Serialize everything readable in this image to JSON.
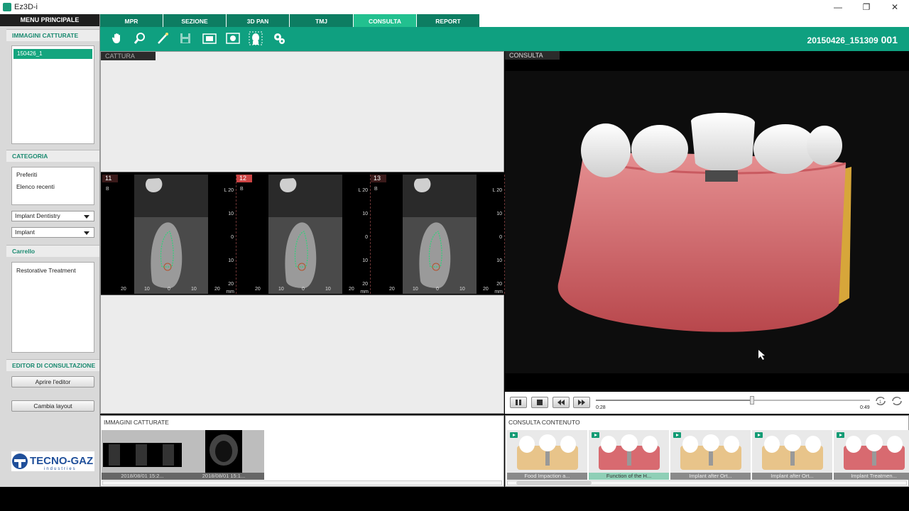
{
  "window": {
    "title": "Ez3D-i"
  },
  "sidebar": {
    "menu_label": "MENU PRINCIPALE",
    "captured_header": "IMMAGINI CATTURATE",
    "captured_items": [
      "150426_1"
    ],
    "category_header": "CATEGORIA",
    "category_items": [
      "Preferiti",
      "Elenco recenti"
    ],
    "dropdown1": "Implant Dentistry",
    "dropdown2": "Implant",
    "cart_header": "Carrello",
    "cart_items": [
      "Restorative Treatment"
    ],
    "editor_header": "EDITOR DI CONSULTAZIONE",
    "open_editor": "Aprire l'editor",
    "change_layout": "Cambia layout",
    "logo_text": "TECNO-GAZ",
    "logo_sub": "industries"
  },
  "tabs": [
    "MPR",
    "SEZIONE",
    "3D PAN",
    "TMJ",
    "CONSULTA",
    "REPORT"
  ],
  "active_tab": "CONSULTA",
  "toolbar": {
    "tools": [
      "hand-icon",
      "zoom-icon",
      "draw-icon",
      "save-icon",
      "capture-icon",
      "screenshot-icon",
      "face-icon",
      "settings-icon"
    ],
    "case_id": "20150426_151309",
    "case_num": "001"
  },
  "capture": {
    "label": "CATTURA",
    "slices": [
      {
        "num": "11",
        "marker": "B"
      },
      {
        "num": "12",
        "marker": "B"
      },
      {
        "num": "13",
        "marker": "B"
      }
    ],
    "right_ticks": [
      "L 20",
      "10",
      "0",
      "10",
      "20"
    ],
    "bottom_ticks": [
      "20",
      "10",
      "0",
      "10",
      "20"
    ],
    "unit": "mm"
  },
  "consulta": {
    "label": "CONSULTA",
    "time_current": "0:28",
    "time_total": "0:49",
    "progress": 0.57
  },
  "captured_images": {
    "title": "IMMAGINI CATTURATE",
    "items": [
      "2018/08/01 15:2...",
      "2018/08/01 15:1..."
    ]
  },
  "content": {
    "title": "CONSULTA CONTENUTO",
    "items": [
      "Food Impaction a...",
      "Function of the H...",
      "Implant after Ort...",
      "Implant after Ort...",
      "Implant Treatmen..."
    ],
    "selected_index": 1
  },
  "colors": {
    "accent": "#0fa080",
    "tab": "#0d7d62",
    "tab_active": "#22c08f",
    "selected": "#14a57e"
  }
}
